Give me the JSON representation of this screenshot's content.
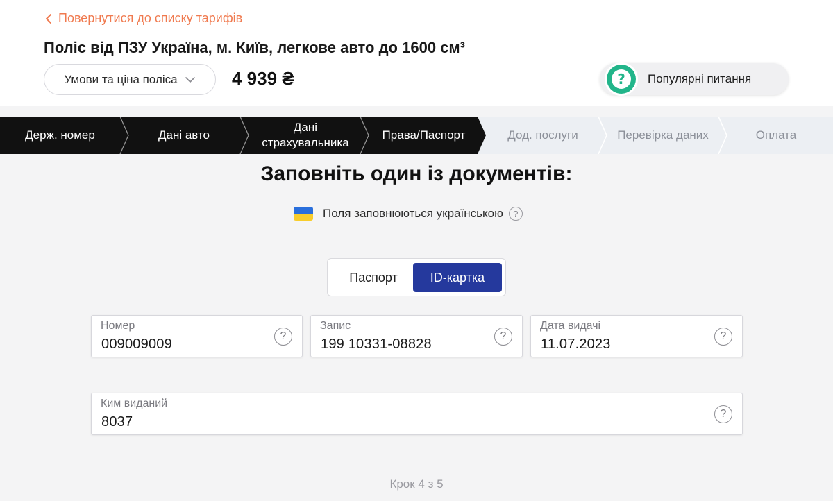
{
  "header": {
    "back_label": "Повернутися до списку тарифів",
    "policy_title": "Поліс від ПЗУ Україна, м. Київ, легкове авто до 1600 см³",
    "conditions_label": "Умови та ціна поліса",
    "price": "4 939 ₴",
    "faq_label": "Популярні питання"
  },
  "steps": [
    {
      "label": "Держ. номер",
      "state": "done"
    },
    {
      "label": "Дані авто",
      "state": "done"
    },
    {
      "label": "Дані страхувальника",
      "state": "done"
    },
    {
      "label": "Права/Паспорт",
      "state": "current"
    },
    {
      "label": "Дод. послуги",
      "state": "todo"
    },
    {
      "label": "Перевірка даних",
      "state": "todo"
    },
    {
      "label": "Оплата",
      "state": "todo"
    }
  ],
  "colors": {
    "accent_orange": "#f07a4f",
    "primary_blue": "#25399d",
    "step_done_bg": "#111111",
    "faq_green": "#22b58a"
  },
  "form": {
    "title": "Заповніть один із документів:",
    "lang_note": "Поля заповнюються українською",
    "doc_types": {
      "passport": "Паспорт",
      "id_card": "ID-картка",
      "selected": "ID-картка"
    },
    "fields": {
      "number": {
        "label": "Номер",
        "value": "009009009"
      },
      "record": {
        "label": "Запис",
        "value": "199 10331-08828"
      },
      "issue_date": {
        "label": "Дата видачі",
        "value": "11.07.2023"
      },
      "issued_by": {
        "label": "Ким виданий",
        "value": "8037"
      }
    },
    "help_glyph": "?"
  },
  "step_counter": "Крок 4 з 5",
  "icons": [
    "chevron-left-icon",
    "chevron-down-icon",
    "question-circle-icon",
    "ukraine-flag-icon"
  ]
}
